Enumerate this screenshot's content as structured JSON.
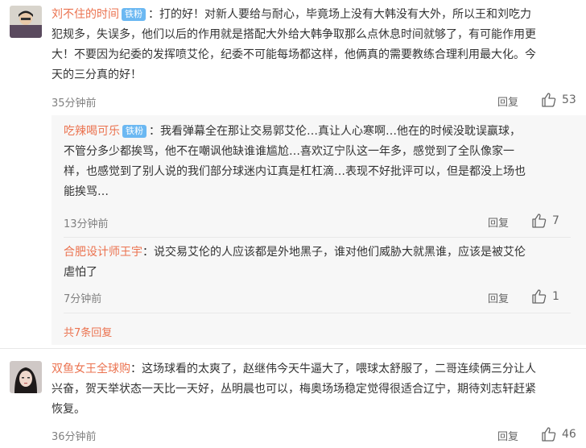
{
  "comments": [
    {
      "user": "刘不住的时间",
      "badge": "铁粉",
      "lines": [
        "：打的好！对新人要给与耐心，毕竟场上没有大韩没有大外，所以王和刘吃力",
        "犯规多，失误多，他们以后的作用就是搭配大外给大韩争取那么点休息时间就够了，有可能作用更",
        "大！不要因为纪委的发挥喷艾伦，纪委不可能每场都这样，他俩真的需要教练合理利用最大化。今",
        "天的三分真的好！"
      ],
      "time": "35分钟前",
      "reply_label": "回复",
      "likes": "53",
      "replies": [
        {
          "user": "吃辣喝可乐",
          "badge": "铁粉",
          "lines": [
            "：我看弹幕全在那让交易郭艾伦…真让人心寒啊…他在的时候没耽误赢球，",
            "不管分多少都挨骂，他不在嘲讽他缺谁谁尴尬…喜欢辽宁队这一年多，感觉到了全队像家一",
            "样，也感觉到了别人说的我们部分球迷内讧真是杠杠滴…表现不好批评可以，但是都没上场也",
            "能挨骂…"
          ],
          "time": "13分钟前",
          "reply_label": "回复",
          "likes": "7"
        },
        {
          "user": "合肥设计师王宇",
          "badge": "",
          "lines": [
            "：说交易艾伦的人应该都是外地黑子，谁对他们威胁大就黑谁，应该是被艾伦",
            "虐怕了"
          ],
          "time": "7分钟前",
          "reply_label": "回复",
          "likes": "1"
        }
      ],
      "more_replies": "共7条回复"
    },
    {
      "user": "双鱼女王全球购",
      "badge": "",
      "lines": [
        "：这场球看的太爽了，赵继伟今天牛逼大了，喂球太舒服了，二哥连续俩三分让人",
        "兴奋，贺天举状态一天比一天好，丛明晨也可以，梅奥场场稳定觉得很适合辽宁，期待刘志轩赶紧",
        "恢复。"
      ],
      "time": "36分钟前",
      "reply_label": "回复",
      "likes": "46"
    }
  ],
  "colors": {
    "username": "#eb7350",
    "badge": "#6bb8f2",
    "reply_bg": "#f7f7f7"
  },
  "icons": {
    "like": "thumbs-up-icon"
  }
}
